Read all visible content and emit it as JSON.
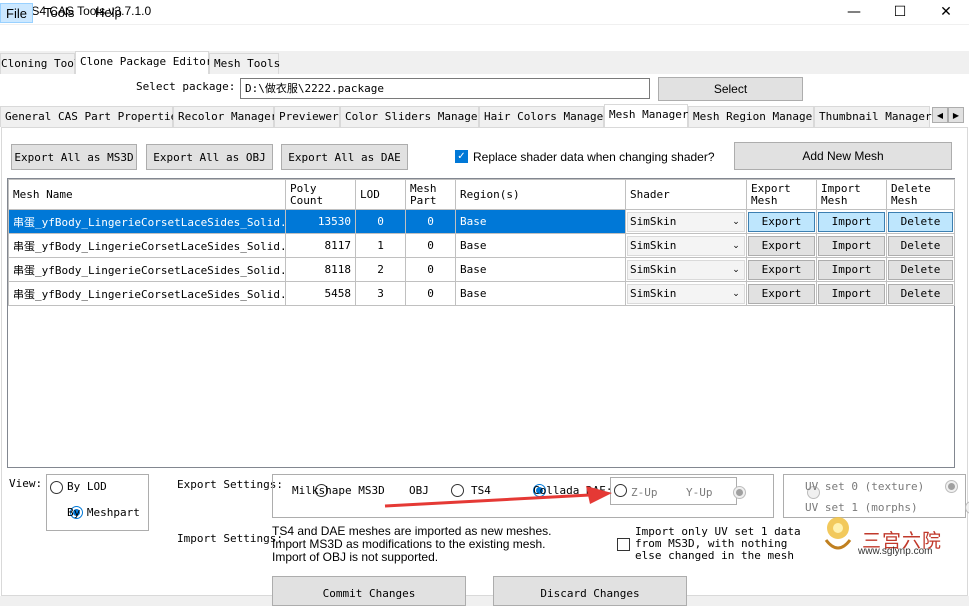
{
  "window": {
    "title": "TS4 CAS Tools v3.7.1.0",
    "minimize": "—",
    "maximize": "☐",
    "close": "✕"
  },
  "menu": [
    "File",
    "Tools",
    "Help"
  ],
  "top_tabs": [
    "Cloning Tool",
    "Clone Package Editor",
    "Mesh Tools"
  ],
  "package": {
    "label": "Select package:",
    "path": "D:\\做衣服\\2222.package",
    "select_button": "Select"
  },
  "sub_tabs": [
    "General CAS Part Properties",
    "Recolor Manager",
    "Previewer",
    "Color Sliders Manager",
    "Hair Colors Manager",
    "Mesh Manager",
    "Mesh Region Manager",
    "Thumbnail Manager"
  ],
  "tab_scroll": {
    "left": "◀",
    "right": "▶"
  },
  "toolbar": {
    "export_ms3d": "Export All as MS3D",
    "export_obj": "Export All as OBJ",
    "export_dae": "Export All as DAE",
    "replace_shader_label": "Replace shader data when changing shader?",
    "replace_shader_checked": true,
    "add_mesh": "Add New Mesh"
  },
  "table": {
    "columns": [
      "Mesh Name",
      "Poly Count",
      "LOD",
      "Mesh Part",
      "Region(s)",
      "Shader",
      "Export Mesh",
      "Import Mesh",
      "Delete Mesh"
    ],
    "rows": [
      {
        "name": "串蛋_yfBody_LingerieCorsetLaceSides_Solid...",
        "poly": "13530",
        "lod": "0",
        "part": "0",
        "region": "Base",
        "shader": "SimSkin",
        "export": "Export",
        "import": "Import",
        "delete": "Delete"
      },
      {
        "name": "串蛋_yfBody_LingerieCorsetLaceSides_Solid...",
        "poly": "8117",
        "lod": "1",
        "part": "0",
        "region": "Base",
        "shader": "SimSkin",
        "export": "Export",
        "import": "Import",
        "delete": "Delete"
      },
      {
        "name": "串蛋_yfBody_LingerieCorsetLaceSides_Solid...",
        "poly": "8118",
        "lod": "2",
        "part": "0",
        "region": "Base",
        "shader": "SimSkin",
        "export": "Export",
        "import": "Import",
        "delete": "Delete"
      },
      {
        "name": "串蛋_yfBody_LingerieCorsetLaceSides_Solid...",
        "poly": "5458",
        "lod": "3",
        "part": "0",
        "region": "Base",
        "shader": "SimSkin",
        "export": "Export",
        "import": "Import",
        "delete": "Delete"
      }
    ]
  },
  "view": {
    "label": "View:",
    "by_lod": "By LOD",
    "by_meshpart": "By Meshpart",
    "selected": "By Meshpart"
  },
  "export_settings": {
    "label": "Export Settings:",
    "formats": [
      "Milkshape MS3D",
      "OBJ",
      "TS4",
      "Collada DAE:"
    ],
    "selected": "TS4",
    "axis": [
      "Z-Up",
      "Y-Up"
    ],
    "uv": [
      "UV set 0 (texture)",
      "UV set 1 (morphs)"
    ]
  },
  "import_settings": {
    "label": "Import Settings:",
    "notes": [
      "TS4 and DAE meshes are imported as new meshes.",
      "Import MS3D as modifications to the existing mesh.",
      "Import of OBJ is not supported."
    ],
    "uv_only_label": "Import only UV set 1 data from MS3D, with nothing else changed in the mesh",
    "uv_only_lines": [
      "Import only UV set 1 data",
      "from MS3D, with nothing",
      "else changed in the mesh"
    ]
  },
  "bottom_buttons": {
    "commit": "Commit Changes",
    "discard": "Discard Changes"
  },
  "watermark": {
    "text": "三宫六院",
    "url": "www.sglynp.com"
  },
  "colors": {
    "selection": "#0078d7",
    "arrow": "#e53935"
  }
}
